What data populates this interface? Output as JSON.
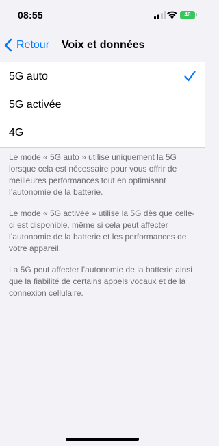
{
  "status_bar": {
    "time": "08:55",
    "battery_level": "46",
    "signal_icon": "cellular-signal-icon",
    "wifi_icon": "wifi-icon"
  },
  "nav": {
    "back_label": "Retour",
    "title": "Voix et données"
  },
  "options": [
    {
      "label": "5G auto",
      "selected": true
    },
    {
      "label": "5G activée",
      "selected": false
    },
    {
      "label": "4G",
      "selected": false
    }
  ],
  "description": {
    "p1": "Le mode « 5G auto » utilise uniquement la 5G lorsque cela est nécessaire pour vous offrir de meilleures performances tout en optimisant l’autonomie de la batterie.",
    "p2": "Le mode « 5G activée » utilise la 5G dès que celle-ci est disponible, même si cela peut affecter l’autonomie de la batterie et les performances de votre appareil.",
    "p3": "La 5G peut affecter l’autonomie de la batterie ainsi que la fiabilité de certains appels vocaux et de la connexion cellulaire."
  },
  "colors": {
    "accent": "#007aff",
    "battery": "#34c759",
    "background": "#f2f2f7"
  }
}
